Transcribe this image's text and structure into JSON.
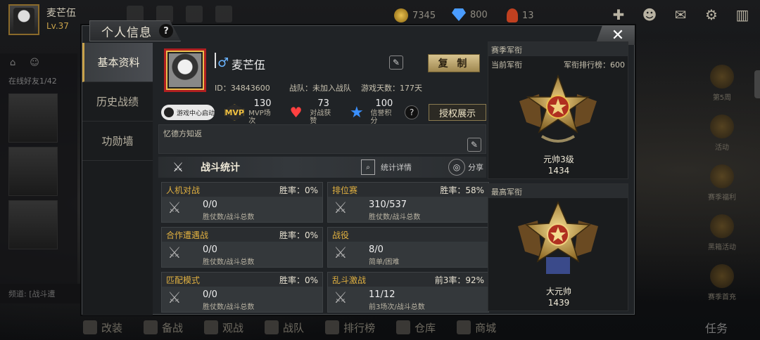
{
  "player": {
    "name": "麦芒伍",
    "level": "Lv.37"
  },
  "currency": {
    "gold": "7345",
    "diamond": "800",
    "medal": "13"
  },
  "left_side": {
    "online": "在线好友1/42"
  },
  "chat": {
    "text": "频道: [战斗遭"
  },
  "dialog": {
    "title": "个人信息",
    "help": "?",
    "close": "✕",
    "nav": [
      "基本资料",
      "历史战绩",
      "功勋墙"
    ]
  },
  "profile": {
    "gender_symbol": "♂",
    "nickname": "麦芒伍",
    "copy_label": "复 制",
    "id_text": "ID：34843600",
    "team_text": "战队：未加入战队",
    "days_text": "游戏天数：177天",
    "game_center": "游戏中心启动",
    "mvp": {
      "badge": "MVP",
      "value": "130",
      "label": "MVP场次"
    },
    "likes": {
      "value": "73",
      "label": "对战获赞"
    },
    "credit": {
      "value": "100",
      "label": "信誉积分"
    },
    "help": "?",
    "auth_label": "授权展示",
    "signature": "忆德方知返"
  },
  "combat": {
    "title": "战斗统计",
    "detail_label": "统计详情",
    "share_label": "分享",
    "cards": [
      {
        "mode": "人机对战",
        "rate": "胜率：0%",
        "value": "0/0",
        "sub": "胜仗数/战斗总数"
      },
      {
        "mode": "排位赛",
        "rate": "胜率：58%",
        "value": "310/537",
        "sub": "胜仗数/战斗总数"
      },
      {
        "mode": "合作遭遇战",
        "rate": "胜率：0%",
        "value": "0/0",
        "sub": "胜仗数/战斗总数"
      },
      {
        "mode": "战役",
        "rate": "",
        "value": "8/0",
        "sub": "简单/困难"
      },
      {
        "mode": "匹配模式",
        "rate": "胜率：0%",
        "value": "0/0",
        "sub": "胜仗数/战斗总数"
      },
      {
        "mode": "乱斗激战",
        "rate": "前3率：92%",
        "value": "11/12",
        "sub": "前3场次/战斗总数"
      }
    ]
  },
  "rank": {
    "season_title": "赛季军衔",
    "current_label": "当前军衔",
    "leaderboard": "军衔排行榜：600",
    "current_name": "元帅3级",
    "current_score": "1434",
    "highest_title": "最高军衔",
    "highest_name": "大元帅",
    "highest_score": "1439"
  },
  "bottom_menu": [
    "改装",
    "备战",
    "观战",
    "战队",
    "排行榜",
    "仓库",
    "商城"
  ],
  "task_label": "任务",
  "right_rail": [
    "第5周",
    "活动",
    "赛季福利",
    "黑箱活动",
    "赛季首充"
  ]
}
